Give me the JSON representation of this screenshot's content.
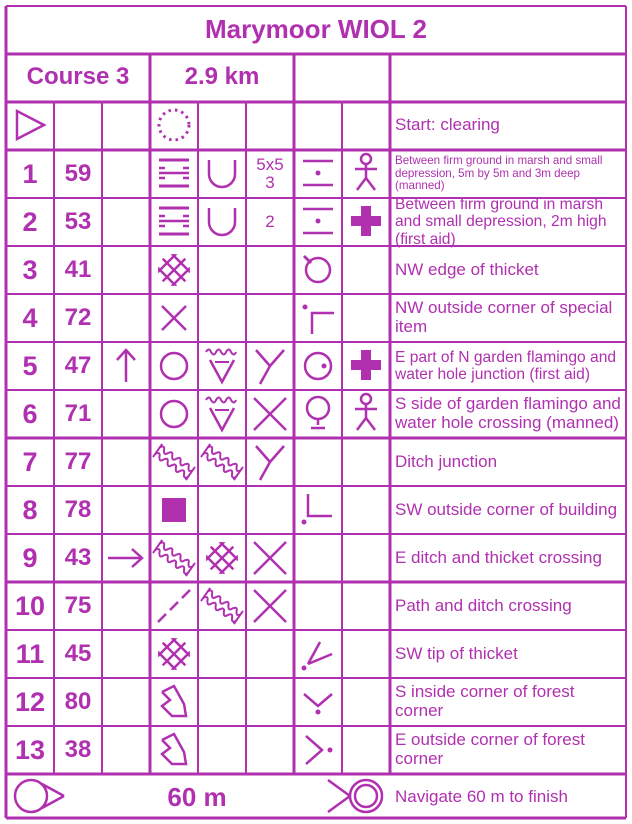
{
  "event": {
    "title": "Marymoor WIOL 2"
  },
  "course": {
    "name": "Course 3",
    "length": "2.9 km"
  },
  "colors": {
    "primary": "#b030b0",
    "background": "#ffffff"
  },
  "start": {
    "symbol": "start-triangle-icon",
    "feature_symbol": "clearing-icon",
    "description": "Start: clearing"
  },
  "controls": [
    {
      "seq": "1",
      "code": "59",
      "direction": "",
      "feature1": "marsh-icon",
      "feature2": "depression-icon",
      "dimensions": "5x5\n3",
      "location": "between-icon",
      "other": "manned-icon",
      "description": "Between firm ground in marsh and small depression, 5m by 5m and 3m deep (manned)",
      "size": "small"
    },
    {
      "seq": "2",
      "code": "53",
      "direction": "",
      "feature1": "marsh-icon",
      "feature2": "depression-icon",
      "dimensions": "2",
      "location": "between-icon",
      "other": "first-aid-icon",
      "description": "Between firm ground in marsh and small depression, 2m high (first aid)",
      "size": "mid"
    },
    {
      "seq": "3",
      "code": "41",
      "direction": "",
      "feature1": "thicket-icon",
      "feature2": "",
      "dimensions": "",
      "location": "nw-edge-icon",
      "other": "",
      "description": "NW edge of thicket",
      "size": "normal"
    },
    {
      "seq": "4",
      "code": "72",
      "direction": "",
      "feature1": "special-item-x-icon",
      "feature2": "",
      "dimensions": "",
      "location": "nw-outside-corner-icon",
      "other": "",
      "description": "NW outside corner of special item",
      "size": "normal"
    },
    {
      "seq": "5",
      "code": "47",
      "direction": "north-arrow-icon",
      "feature1": "garden-flamingo-icon",
      "feature2": "water-hole-icon",
      "dimensions": "junction-icon",
      "location": "east-part-icon",
      "other": "first-aid-icon",
      "description": "E part of N garden flamingo and water hole junction (first aid)",
      "size": "mid"
    },
    {
      "seq": "6",
      "code": "71",
      "direction": "",
      "feature1": "garden-flamingo-icon",
      "feature2": "water-hole-icon",
      "dimensions": "crossing-icon",
      "location": "south-side-icon",
      "other": "manned-icon",
      "description": "S side of garden flamingo and water hole crossing (manned)",
      "size": "normal"
    },
    {
      "seq": "7",
      "code": "77",
      "direction": "",
      "feature1": "ditch-icon",
      "feature2": "ditch-icon",
      "dimensions": "junction-icon",
      "location": "",
      "other": "",
      "description": "Ditch junction",
      "size": "normal"
    },
    {
      "seq": "8",
      "code": "78",
      "direction": "",
      "feature1": "building-icon",
      "feature2": "",
      "dimensions": "",
      "location": "sw-outside-corner-icon",
      "other": "",
      "description": "SW outside corner of building",
      "size": "normal"
    },
    {
      "seq": "9",
      "code": "43",
      "direction": "east-arrow-icon",
      "feature1": "ditch-icon",
      "feature2": "thicket-icon",
      "dimensions": "crossing-icon",
      "location": "",
      "other": "",
      "description": "E ditch and thicket crossing",
      "size": "normal"
    },
    {
      "seq": "10",
      "code": "75",
      "direction": "",
      "feature1": "path-icon",
      "feature2": "ditch-icon",
      "dimensions": "crossing-icon",
      "location": "",
      "other": "",
      "description": "Path and ditch crossing",
      "size": "normal"
    },
    {
      "seq": "11",
      "code": "45",
      "direction": "",
      "feature1": "thicket-icon",
      "feature2": "",
      "dimensions": "",
      "location": "sw-tip-icon",
      "other": "",
      "description": "SW tip of thicket",
      "size": "normal"
    },
    {
      "seq": "12",
      "code": "80",
      "direction": "",
      "feature1": "forest-corner-icon",
      "feature2": "",
      "dimensions": "",
      "location": "s-inside-corner-icon",
      "other": "",
      "description": "S inside corner of forest corner",
      "size": "normal"
    },
    {
      "seq": "13",
      "code": "38",
      "direction": "",
      "feature1": "forest-corner-icon",
      "feature2": "",
      "dimensions": "",
      "location": "e-outside-corner-icon",
      "other": "",
      "description": "E outside corner of forest corner",
      "size": "normal"
    }
  ],
  "finish": {
    "distance": "60 m",
    "start_symbol": "navigate-out-icon",
    "end_symbol": "finish-circle-icon",
    "description": "Navigate 60 m to finish"
  }
}
